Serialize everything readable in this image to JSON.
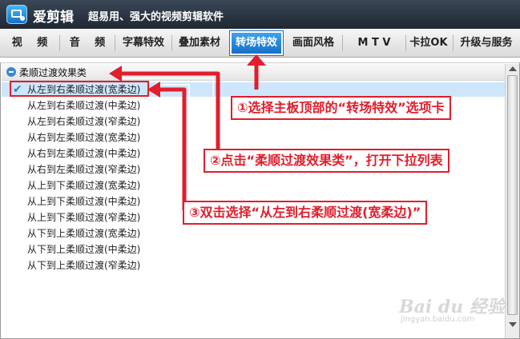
{
  "window": {
    "app_name": "爱剪辑",
    "slogan": "超易用、强大的视频剪辑软件"
  },
  "tabs": [
    {
      "label": "视 频",
      "active": false
    },
    {
      "label": "音 频",
      "active": false
    },
    {
      "label": "字幕特效",
      "active": false
    },
    {
      "label": "叠加素材",
      "active": false
    },
    {
      "label": "转场特效",
      "active": true
    },
    {
      "label": "画面风格",
      "active": false
    },
    {
      "label": "M T V",
      "active": false
    },
    {
      "label": "卡拉OK",
      "active": false
    },
    {
      "label": "升级与服务",
      "active": false
    }
  ],
  "category": {
    "label": "柔顺过渡效果类",
    "expanded": true
  },
  "items": [
    {
      "label": "从左到右柔顺过渡(宽柔边)",
      "selected": true
    },
    {
      "label": "从左到右柔顺过渡(中柔边)"
    },
    {
      "label": "从左到右柔顺过渡(窄柔边)"
    },
    {
      "label": "从右到左柔顺过渡(宽柔边)"
    },
    {
      "label": "从右到左柔顺过渡(中柔边)"
    },
    {
      "label": "从右到左柔顺过渡(窄柔边)"
    },
    {
      "label": "从上到下柔顺过渡(宽柔边)"
    },
    {
      "label": "从上到下柔顺过渡(中柔边)"
    },
    {
      "label": "从上到下柔顺过渡(窄柔边)"
    },
    {
      "label": "从下到上柔顺过渡(宽柔边)"
    },
    {
      "label": "从下到上柔顺过渡(中柔边)"
    },
    {
      "label": "从下到上柔顺过渡(窄柔边)"
    }
  ],
  "annotations": [
    "①选择主板顶部的“转场特效”选项卡",
    "②点击“柔顺过渡效果类”，打开下拉列表",
    "③双击选择“从左到右柔顺过渡(宽柔边)”"
  ],
  "watermark": {
    "text": "Bai du 经验",
    "url": "jingyan.baidu.com"
  },
  "colors": {
    "accent": "#1e7fd8",
    "annotation": "#e01e2c",
    "selected_row": "#cde6fb"
  }
}
